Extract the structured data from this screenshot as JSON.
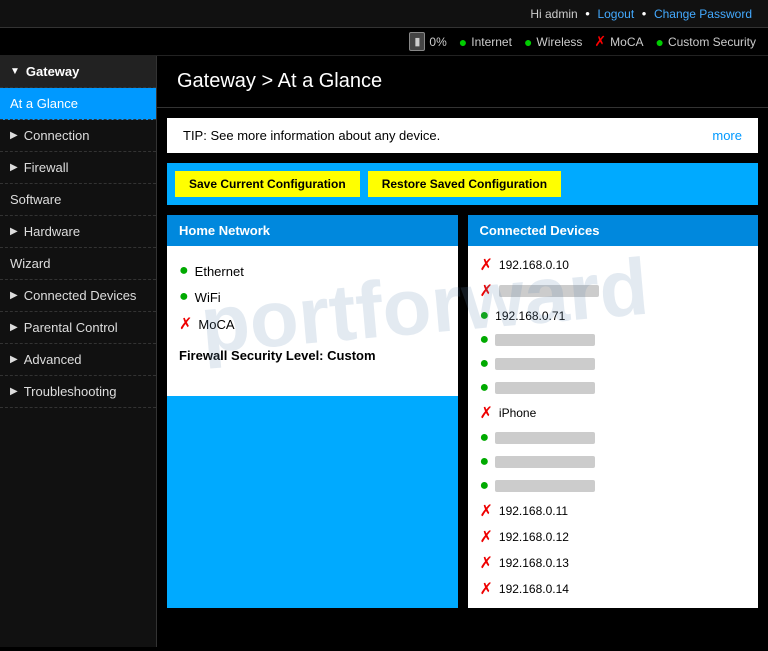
{
  "topbar": {
    "greeting": "Hi admin",
    "logout": "Logout",
    "change_password": "Change Password"
  },
  "statusbar": {
    "battery": "0%",
    "internet": "Internet",
    "wireless": "Wireless",
    "moca": "MoCA",
    "custom_security": "Custom Security"
  },
  "sidebar": {
    "items": [
      {
        "label": "Gateway",
        "type": "group",
        "arrow": "▼"
      },
      {
        "label": "At a Glance",
        "type": "active"
      },
      {
        "label": "Connection",
        "type": "collapsible",
        "arrow": "▶"
      },
      {
        "label": "Firewall",
        "type": "collapsible",
        "arrow": "▶"
      },
      {
        "label": "Software",
        "type": "plain"
      },
      {
        "label": "Hardware",
        "type": "collapsible",
        "arrow": "▶"
      },
      {
        "label": "Wizard",
        "type": "plain"
      },
      {
        "label": "Connected Devices",
        "type": "collapsible",
        "arrow": "▶"
      },
      {
        "label": "Parental Control",
        "type": "collapsible",
        "arrow": "▶"
      },
      {
        "label": "Advanced",
        "type": "collapsible",
        "arrow": "▶"
      },
      {
        "label": "Troubleshooting",
        "type": "collapsible",
        "arrow": "▶"
      }
    ]
  },
  "page": {
    "title": "Gateway > At a Glance"
  },
  "tip": {
    "text": "TIP: See more information about any device.",
    "link": "more"
  },
  "actions": {
    "save": "Save Current Configuration",
    "restore": "Restore Saved Configuration"
  },
  "home_network": {
    "title": "Home Network",
    "items": [
      {
        "label": "Ethernet",
        "status": "ok"
      },
      {
        "label": "WiFi",
        "status": "ok"
      },
      {
        "label": "MoCA",
        "status": "err"
      }
    ],
    "firewall_label": "Firewall Security Level:",
    "firewall_value": "Custom"
  },
  "connected_devices": {
    "title": "Connected Devices",
    "items": [
      {
        "label": "192.168.0.10",
        "status": "err",
        "blurred": false
      },
      {
        "label": "",
        "status": "err",
        "blurred": true
      },
      {
        "label": "192.168.0.71",
        "status": "ok",
        "blurred": false
      },
      {
        "label": "",
        "status": "ok",
        "blurred": true
      },
      {
        "label": "",
        "status": "ok",
        "blurred": true
      },
      {
        "label": "",
        "status": "ok",
        "blurred": true
      },
      {
        "label": "iPhone",
        "status": "err",
        "blurred": false
      },
      {
        "label": "",
        "status": "ok",
        "blurred": true
      },
      {
        "label": "",
        "status": "ok",
        "blurred": true
      },
      {
        "label": "",
        "status": "ok",
        "blurred": true
      },
      {
        "label": "192.168.0.11",
        "status": "err",
        "blurred": false
      },
      {
        "label": "192.168.0.12",
        "status": "err",
        "blurred": false
      },
      {
        "label": "192.168.0.13",
        "status": "err",
        "blurred": false
      },
      {
        "label": "192.168.0.14",
        "status": "err",
        "blurred": false
      }
    ]
  },
  "watermark": "portforward"
}
